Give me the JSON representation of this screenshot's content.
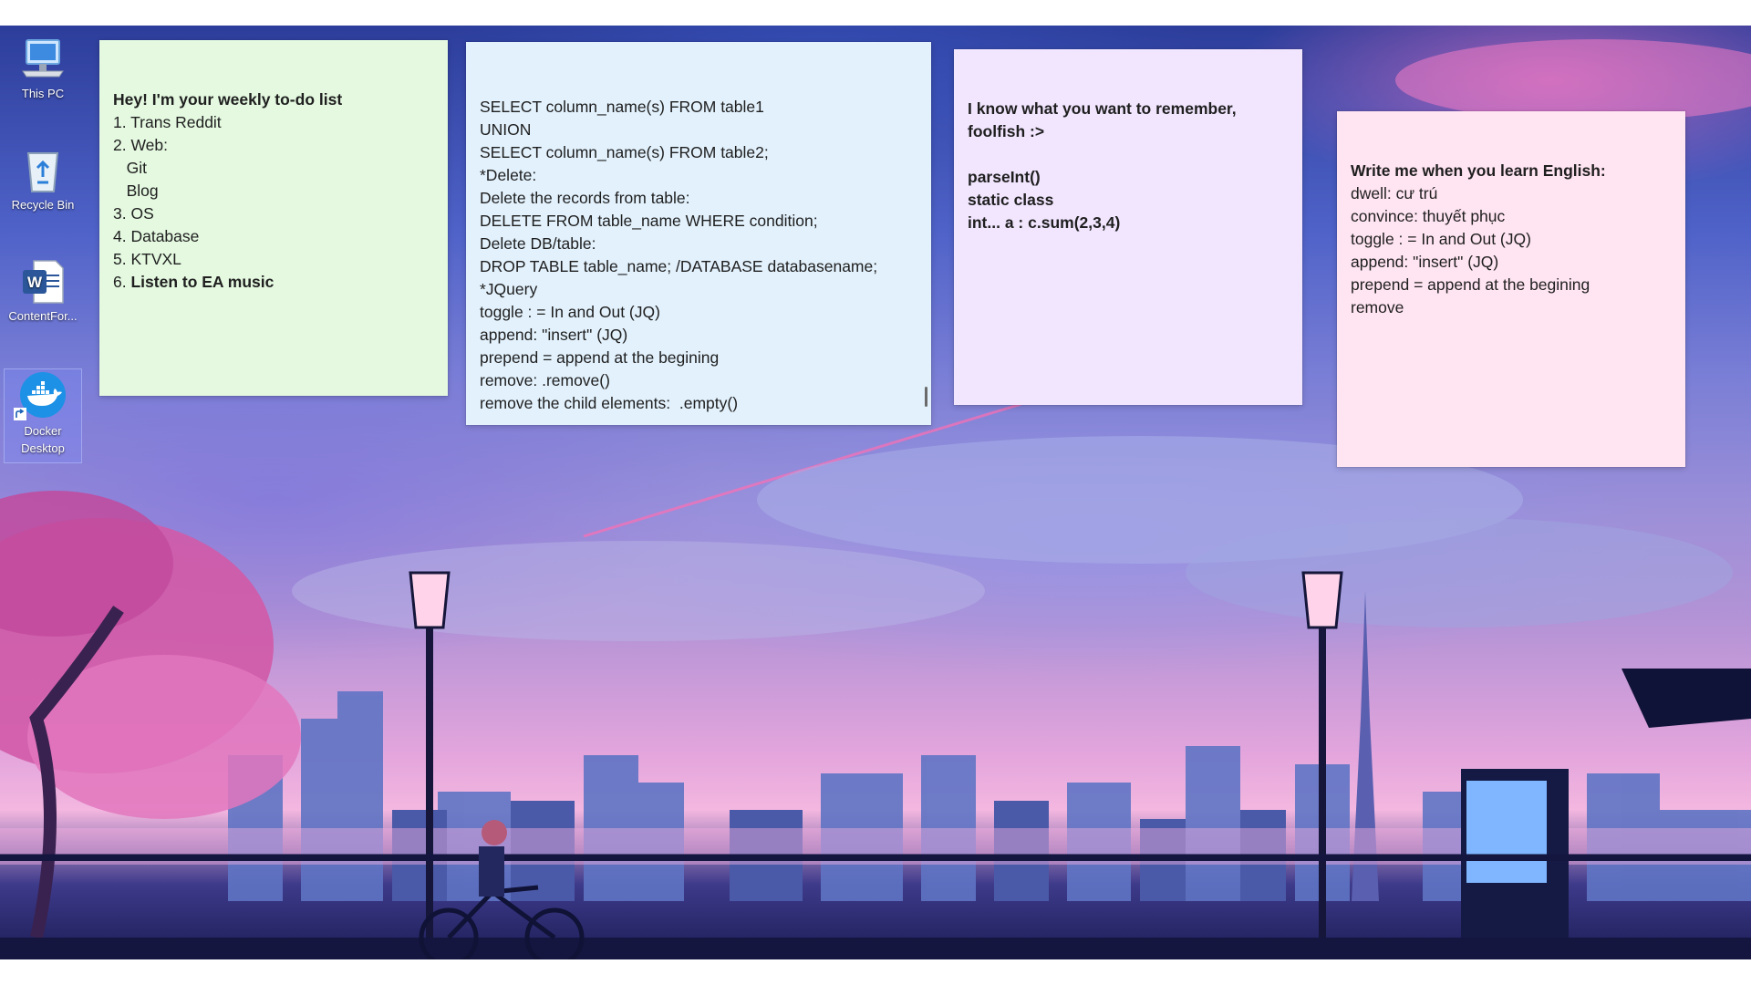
{
  "desktop": {
    "icons": [
      {
        "label": "This PC",
        "icon": "this-pc-icon"
      },
      {
        "label": "Recycle Bin",
        "icon": "recycle-bin-icon"
      },
      {
        "label": "ContentFor...",
        "icon": "word-document-icon"
      },
      {
        "label": "Docker Desktop",
        "icon": "docker-icon"
      }
    ]
  },
  "notes": [
    {
      "color": "#e4f9e0",
      "lines": [
        {
          "text": "Hey! I'm your weekly to-do list",
          "bold": true
        },
        {
          "text": "1. Trans Reddit",
          "bold": false
        },
        {
          "text": "2. Web:",
          "bold": false
        },
        {
          "text": "   Git",
          "bold": false
        },
        {
          "text": "   Blog",
          "bold": false
        },
        {
          "text": "3. OS",
          "bold": false
        },
        {
          "text": "4. Database",
          "bold": false
        },
        {
          "text": "5. KTVXL",
          "bold": false
        },
        {
          "prefix": "6. ",
          "text": "Listen to EA music",
          "bold": true
        }
      ]
    },
    {
      "color": "#e2f1fc",
      "lines": [
        {
          "text": "SELECT column_name(s) FROM table1"
        },
        {
          "text": "UNION"
        },
        {
          "text": "SELECT column_name(s) FROM table2;"
        },
        {
          "text": "*Delete:"
        },
        {
          "text": "Delete the records from table:"
        },
        {
          "text": "DELETE FROM table_name WHERE condition;"
        },
        {
          "text": "Delete DB/table:"
        },
        {
          "text": "DROP TABLE table_name; /DATABASE databasename;"
        },
        {
          "text": "*JQuery"
        },
        {
          "text": "toggle : = In and Out (JQ)"
        },
        {
          "text": "append: \"insert\" (JQ)"
        },
        {
          "text": "prepend = append at the begining"
        },
        {
          "text": "remove: .remove()"
        },
        {
          "text": "remove the child elements:  .empty()"
        }
      ]
    },
    {
      "color": "#f2e6ff",
      "lines": [
        {
          "text": "I know what you want to remember,",
          "bold": true
        },
        {
          "text": "foolfish :>",
          "bold": true
        },
        {
          "text": " ",
          "bold": false
        },
        {
          "text": "parseInt()",
          "bold": true
        },
        {
          "text": "static class",
          "bold": true
        },
        {
          "text": "int... a : c.sum(2,3,4)",
          "bold": true
        }
      ]
    },
    {
      "color": "#ffe4f1",
      "lines": [
        {
          "text": "Write me when you learn English:",
          "bold": true
        },
        {
          "text": "dwell: cư trú",
          "bold": false
        },
        {
          "text": "convince: thuyết phục",
          "bold": false
        },
        {
          "text": "toggle : = In and Out (JQ)",
          "bold": false
        },
        {
          "text": "append: \"insert\" (JQ)",
          "bold": false
        },
        {
          "text": "prepend = append at the begining",
          "bold": false
        },
        {
          "text": "remove",
          "bold": false
        }
      ]
    }
  ]
}
